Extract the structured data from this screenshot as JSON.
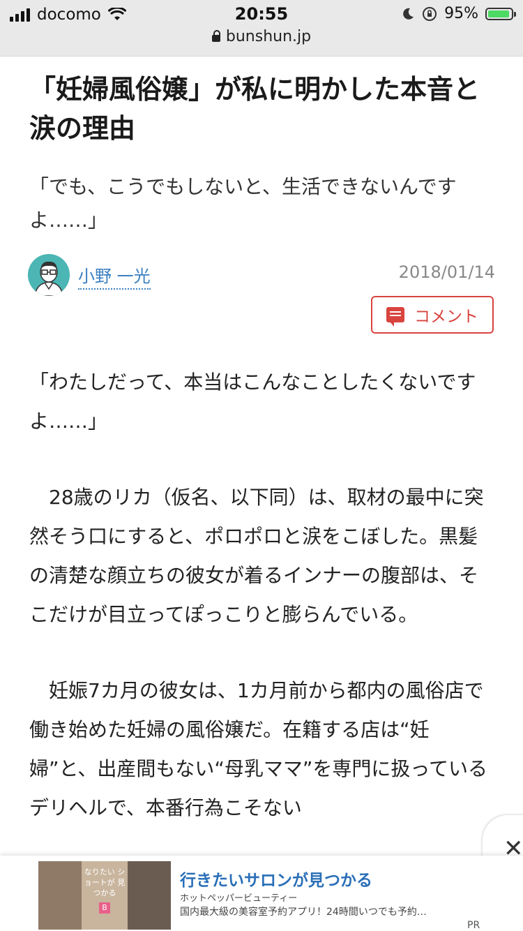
{
  "status": {
    "carrier": "docomo",
    "time": "20:55",
    "battery": "95%",
    "battery_level": 0.95,
    "url": "bunshun.jp"
  },
  "article": {
    "title": "「妊婦風俗嬢」が私に明かした本音と涙の理由",
    "subtitle": "「でも、こうでもしないと、生活できないんですよ……」",
    "author": "小野 一光",
    "date": "2018/01/14",
    "comment_label": "コメント",
    "paragraphs": [
      "「わたしだって、本当はこんなことしたくないですよ……」",
      "　28歳のリカ（仮名、以下同）は、取材の最中に突然そう口にすると、ポロポロと涙をこぼした。黒髪の清楚な顔立ちの彼女が着るインナーの腹部は、そこだけが目立ってぽっこりと膨らんでいる。",
      "　妊娠7カ月の彼女は、1カ月前から都内の風俗店で働き始めた妊婦の風俗嬢だ。在籍する店は“妊婦”と、出産間もない“母乳ママ”を専門に扱っているデリヘルで、本番行為こそない"
    ]
  },
  "ad": {
    "image_text": "なりたい ショートが 見つかる",
    "image_badge": "B",
    "title": "行きたいサロンが見つかる",
    "brand": "ホットペッパービューティー",
    "description": "国内最大級の美容室予約アプリ！24時間いつでも予約…",
    "pr": "PR",
    "close_symbol": "✕"
  }
}
